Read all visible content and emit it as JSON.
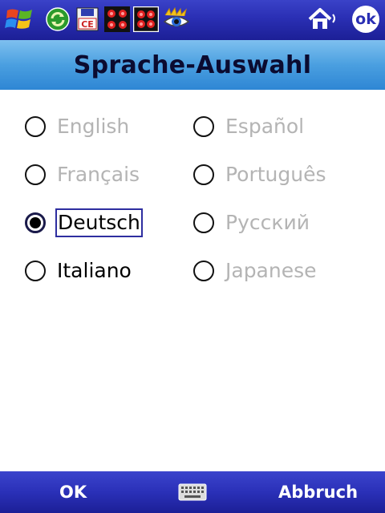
{
  "window": {
    "title": "Sprache-Auswahl"
  },
  "taskbar": {
    "ok_label": "ok"
  },
  "languages": [
    {
      "label": "English",
      "enabled": false,
      "selected": false
    },
    {
      "label": "Español",
      "enabled": false,
      "selected": false
    },
    {
      "label": "Français",
      "enabled": false,
      "selected": false
    },
    {
      "label": "Português",
      "enabled": false,
      "selected": false
    },
    {
      "label": "Deutsch",
      "enabled": true,
      "selected": true
    },
    {
      "label": "Русский",
      "enabled": false,
      "selected": false
    },
    {
      "label": "Italiano",
      "enabled": true,
      "selected": false
    },
    {
      "label": "Japanese",
      "enabled": false,
      "selected": false
    }
  ],
  "softkeys": {
    "left": "OK",
    "right": "Abbruch"
  },
  "colors": {
    "taskbar": "#2a2fb4",
    "titlebar": "#4a9fe0",
    "disabled_text": "#b4b4b4",
    "focus_border": "#2e2ea0"
  }
}
